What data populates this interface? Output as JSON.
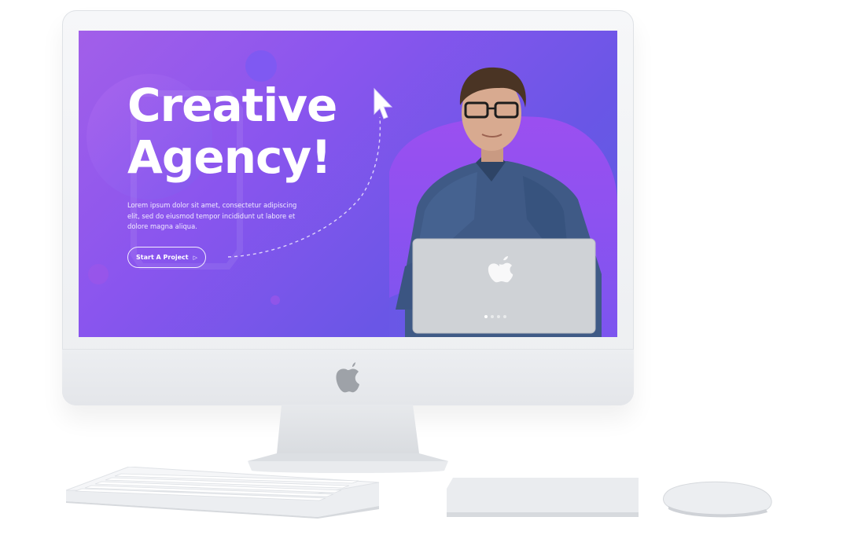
{
  "hero": {
    "title_line1": "Creative",
    "title_line2": "Agency!",
    "body": "Lorem ipsum dolor sit amet, consectetur adipiscing elit, sed do eiusmod tempor incididunt ut labore et dolore magna aliqua.",
    "cta_label": "Start A Project",
    "cta_icon": "play-triangle-icon"
  },
  "slider": {
    "slide_count": 4,
    "active_index": 0
  },
  "colors": {
    "gradient_start": "#a25fe9",
    "gradient_end": "#5a5ee0",
    "text": "#ffffff"
  },
  "icons": {
    "cursor": "mouse-cursor-icon",
    "apple_logo": "apple-logo-icon"
  }
}
